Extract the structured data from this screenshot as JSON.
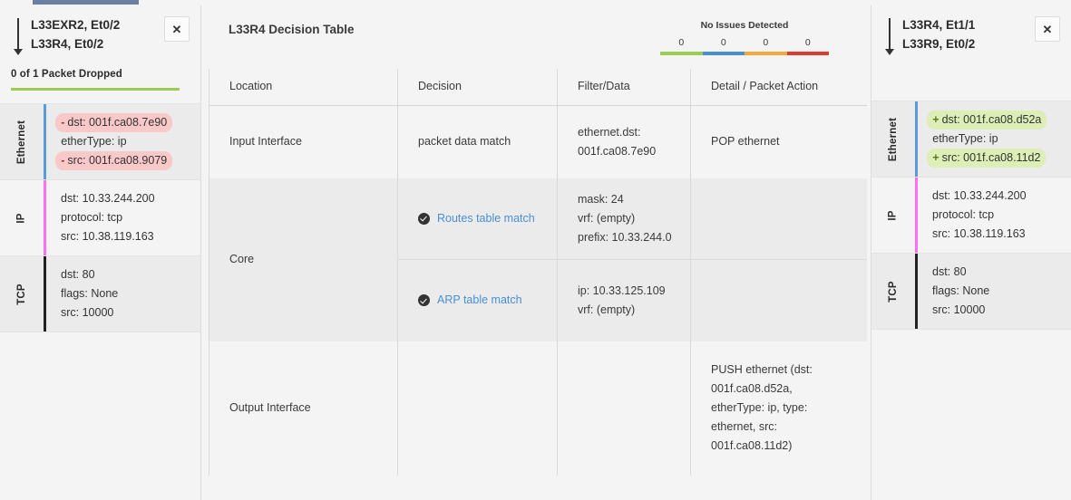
{
  "tabs": {
    "active_indicator": true,
    "accent_color": "#6b7fa3"
  },
  "left_panel": {
    "arrow_icon": "arrow-down-icon",
    "title_line1": "L33EXR2, Et0/2",
    "title_line2": "L33R4, Et0/2",
    "close_label": "✕",
    "dropped_text": "0 of 1 Packet Dropped",
    "dropped_bar_color": "#9ccc52",
    "layers": [
      {
        "name": "Ethernet",
        "accent": "#5b9bd5",
        "fields": [
          {
            "sign": "-",
            "text": "dst: 001f.ca08.7e90",
            "state": "removed"
          },
          {
            "sign": "",
            "text": "etherType: ip",
            "state": "plain"
          },
          {
            "sign": "-",
            "text": "src: 001f.ca08.9079",
            "state": "removed"
          }
        ]
      },
      {
        "name": "IP",
        "accent": "#ff6ff0",
        "fields": [
          {
            "sign": "",
            "text": "dst: 10.33.244.200",
            "state": "plain"
          },
          {
            "sign": "",
            "text": "protocol: tcp",
            "state": "plain"
          },
          {
            "sign": "",
            "text": "src: 10.38.119.163",
            "state": "plain"
          }
        ]
      },
      {
        "name": "TCP",
        "accent": "#222222",
        "fields": [
          {
            "sign": "",
            "text": "dst: 80",
            "state": "plain"
          },
          {
            "sign": "",
            "text": "flags: None",
            "state": "plain"
          },
          {
            "sign": "",
            "text": "src: 10000",
            "state": "plain"
          }
        ]
      }
    ]
  },
  "right_panel": {
    "arrow_icon": "arrow-down-icon",
    "title_line1": "L33R4, Et1/1",
    "title_line2": "L33R9, Et0/2",
    "close_label": "✕",
    "layers": [
      {
        "name": "Ethernet",
        "accent": "#5b9bd5",
        "fields": [
          {
            "sign": "+",
            "text": "dst: 001f.ca08.d52a",
            "state": "added"
          },
          {
            "sign": "",
            "text": "etherType: ip",
            "state": "plain"
          },
          {
            "sign": "+",
            "text": "src: 001f.ca08.11d2",
            "state": "added"
          }
        ]
      },
      {
        "name": "IP",
        "accent": "#ff6ff0",
        "fields": [
          {
            "sign": "",
            "text": "dst: 10.33.244.200",
            "state": "plain"
          },
          {
            "sign": "",
            "text": "protocol: tcp",
            "state": "plain"
          },
          {
            "sign": "",
            "text": "src: 10.38.119.163",
            "state": "plain"
          }
        ]
      },
      {
        "name": "TCP",
        "accent": "#222222",
        "fields": [
          {
            "sign": "",
            "text": "dst: 80",
            "state": "plain"
          },
          {
            "sign": "",
            "text": "flags: None",
            "state": "plain"
          },
          {
            "sign": "",
            "text": "src: 10000",
            "state": "plain"
          }
        ]
      }
    ]
  },
  "center": {
    "title": "L33R4 Decision Table",
    "issues": {
      "label": "No Issues Detected",
      "counts": [
        "0",
        "0",
        "0",
        "0"
      ],
      "colors": [
        "#9ccc52",
        "#4a8fd4",
        "#f5a93c",
        "#e03b30"
      ]
    },
    "table": {
      "headers": [
        "Location",
        "Decision",
        "Filter/Data",
        "Detail / Packet Action"
      ],
      "rows": [
        {
          "location": "Input Interface",
          "decision": "packet data match",
          "filter_lines": [
            "ethernet.dst:",
            "001f.ca08.7e90"
          ],
          "detail_lines": [
            "POP ethernet"
          ]
        },
        {
          "location": "Core",
          "sub_rows": [
            {
              "decision_link": "Routes table match",
              "icon": "check-circle-icon",
              "filter_lines": [
                "mask: 24",
                "vrf: (empty)",
                "prefix: 10.33.244.0"
              ],
              "detail_lines": []
            },
            {
              "decision_link": "ARP table match",
              "icon": "check-circle-icon",
              "filter_lines": [
                "ip: 10.33.125.109",
                "vrf: (empty)"
              ],
              "detail_lines": []
            }
          ]
        },
        {
          "location": "Output Interface",
          "decision": "",
          "filter_lines": [],
          "detail_lines": [
            "PUSH ethernet (dst:",
            "001f.ca08.d52a,",
            "etherType: ip, type:",
            "ethernet, src:",
            "001f.ca08.11d2)"
          ]
        }
      ]
    }
  }
}
